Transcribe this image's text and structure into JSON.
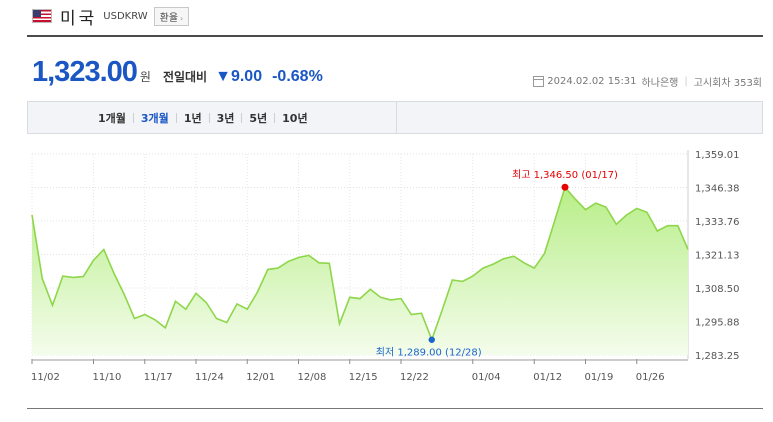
{
  "header": {
    "country": "미국",
    "code": "USDKRW",
    "rate_button": "환율",
    "flag_icon": "us-flag-icon"
  },
  "quote": {
    "price": "1,323.00",
    "unit": "원",
    "compare_label": "전일대비",
    "change": "▼9.00",
    "change_pct": "-0.68%",
    "datetime": "2024.02.02 15:31",
    "bank": "하나은행",
    "notice_count": "고시회차 353회"
  },
  "tabs": [
    {
      "label": "1개월",
      "active": false
    },
    {
      "label": "3개월",
      "active": true
    },
    {
      "label": "1년",
      "active": false
    },
    {
      "label": "3년",
      "active": false
    },
    {
      "label": "5년",
      "active": false
    },
    {
      "label": "10년",
      "active": false
    }
  ],
  "colors": {
    "accent": "#1a56c4",
    "line": "#8ed64a",
    "fill_top": "#b8ee88",
    "high": "#e60000",
    "low": "#1a66cc"
  },
  "chart_data": {
    "type": "area",
    "y_ticks": [
      "1,359.01",
      "1,346.38",
      "1,333.76",
      "1,321.13",
      "1,308.50",
      "1,295.88",
      "1,283.25"
    ],
    "y_range": [
      1283.25,
      1359.01
    ],
    "x_ticks": [
      "11/02",
      "11/10",
      "11/17",
      "11/24",
      "12/01",
      "12/08",
      "12/15",
      "12/22",
      "01/04",
      "01/12",
      "01/19",
      "01/26"
    ],
    "x_tick_index": [
      0,
      6,
      11,
      16,
      21,
      26,
      31,
      36,
      43,
      49,
      54,
      59
    ],
    "values": [
      1336.0,
      1312.0,
      1302.0,
      1313.0,
      1312.5,
      1312.8,
      1319.0,
      1323.0,
      1314.0,
      1306.0,
      1297.0,
      1298.5,
      1296.5,
      1293.5,
      1303.5,
      1300.5,
      1306.5,
      1303.0,
      1297.0,
      1295.5,
      1302.5,
      1300.5,
      1307.0,
      1315.5,
      1316.0,
      1318.5,
      1320.0,
      1320.8,
      1318.0,
      1317.8,
      1295.0,
      1305.0,
      1304.5,
      1308.0,
      1305.0,
      1304.0,
      1304.5,
      1298.5,
      1299.0,
      1289.0,
      1300.0,
      1311.5,
      1311.0,
      1313.0,
      1316.0,
      1317.5,
      1319.5,
      1320.5,
      1318.0,
      1316.0,
      1321.5,
      1334.0,
      1346.5,
      1342.0,
      1338.0,
      1340.5,
      1339.0,
      1332.5,
      1336.0,
      1338.5,
      1337.0,
      1330.0,
      1332.0,
      1332.0,
      1323.0
    ],
    "high": {
      "label": "최고 1,346.50 (01/17)",
      "index": 52
    },
    "low": {
      "label": "최저 1,289.00 (12/28)",
      "index": 39
    }
  }
}
